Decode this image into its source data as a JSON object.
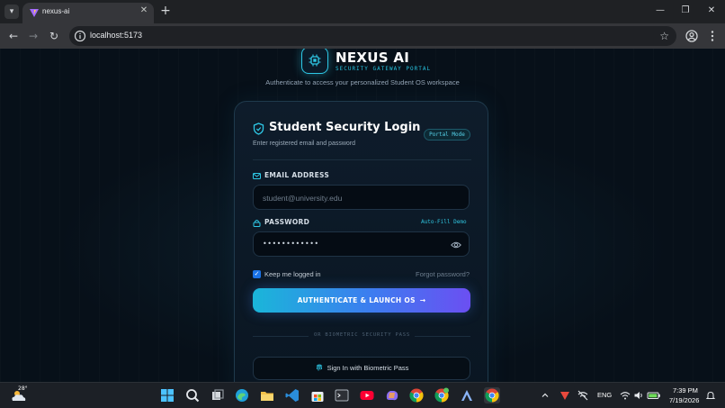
{
  "browser": {
    "tab_title": "nexus-ai",
    "url": "localhost:5173"
  },
  "brand": {
    "name": "NEXUS AI",
    "subtitle": "SECURITY GATEWAY PORTAL",
    "tagline": "Authenticate to access your personalized Student OS workspace"
  },
  "login_card": {
    "title": "Student Security Login",
    "subtitle": "Enter registered email and password",
    "mode_badge": "Portal Mode",
    "email_label": "EMAIL ADDRESS",
    "email_placeholder": "student@university.edu",
    "password_label": "PASSWORD",
    "autofill_label": "Auto-Fill Demo",
    "password_value": "••••••••••••",
    "remember_label": "Keep me logged in",
    "remember_checked": true,
    "forgot_label": "Forgot password?",
    "submit_label": "AUTHENTICATE & LAUNCH OS",
    "divider_text": "OR BIOMETRIC SECURITY PASS",
    "biometric_label": "Sign In with Biometric Pass"
  },
  "taskbar": {
    "temperature": "28°",
    "language": "ENG",
    "time": "7:39 PM",
    "date": "7/19/2026"
  },
  "colors": {
    "accent_cyan": "#2ec8e6",
    "accent_purple": "#6b4ff2",
    "background": "#071019"
  }
}
